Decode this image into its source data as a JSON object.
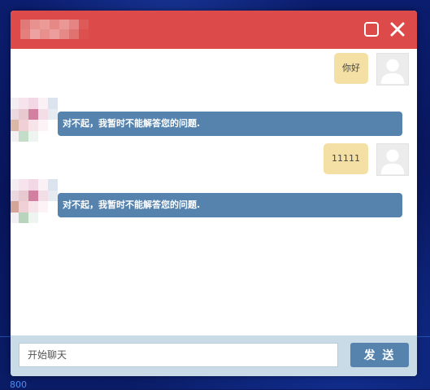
{
  "window": {
    "maximize_icon": "square-outline-icon",
    "close_icon": "close-x-icon",
    "title_color": "#dd4a4a"
  },
  "messages": [
    {
      "side": "right",
      "text": "你好"
    },
    {
      "side": "left",
      "text": "对不起，我暂时不能解答您的问题."
    },
    {
      "side": "right",
      "text": "11111"
    },
    {
      "side": "left",
      "text": "对不起，我暂时不能解答您的问题."
    }
  ],
  "composer": {
    "placeholder": "开始聊天",
    "send_label": "发 送"
  },
  "background": {
    "label": "800"
  },
  "colors": {
    "user_bubble": "#f4e0a4",
    "bot_bubble": "#5583ad",
    "footer": "#c8dbe6"
  }
}
